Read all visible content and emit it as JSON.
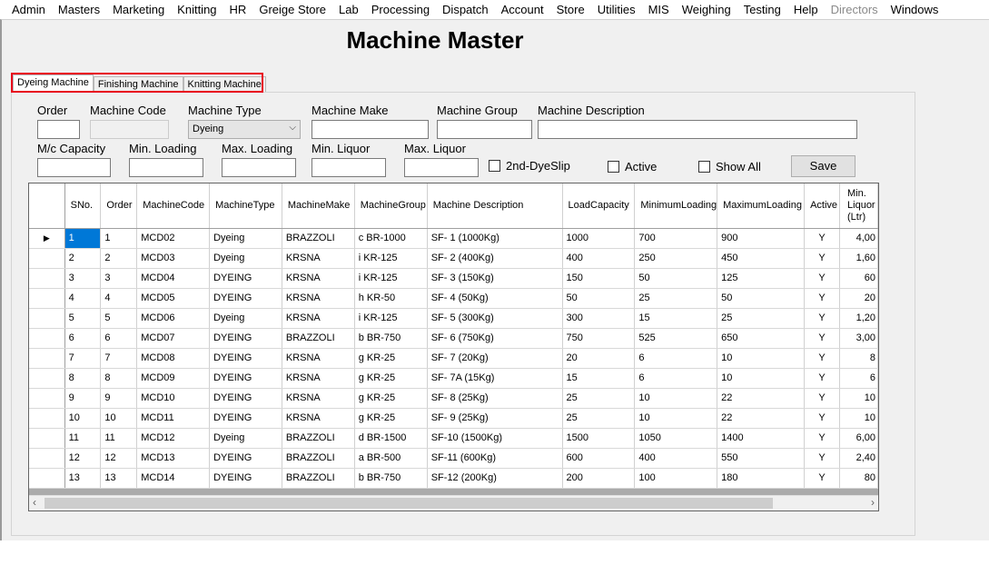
{
  "menu": [
    "Admin",
    "Masters",
    "Marketing",
    "Knitting",
    "HR",
    "Greige Store",
    "Lab",
    "Processing",
    "Dispatch",
    "Account",
    "Store",
    "Utilities",
    "MIS",
    "Weighing",
    "Testing",
    "Help",
    "Directors",
    "Windows"
  ],
  "title": "Machine Master",
  "tabs": [
    "Dyeing Machine",
    "Finishing Machine",
    "Knitting Machine"
  ],
  "form": {
    "order_label": "Order",
    "code_label": "Machine Code",
    "type_label": "Machine Type",
    "type_value": "Dyeing",
    "make_label": "Machine Make",
    "group_label": "Machine Group",
    "desc_label": "Machine Description",
    "capacity_label": "M/c Capacity",
    "min_loading_label": "Min. Loading",
    "max_loading_label": "Max. Loading",
    "min_liquor_label": "Min. Liquor",
    "max_liquor_label": "Max. Liquor",
    "dyeslip_label": "2nd-DyeSlip",
    "active_label": "Active",
    "showall_label": "Show All",
    "save_label": "Save"
  },
  "grid": {
    "columns": [
      "SNo.",
      "Order",
      "MachineCode",
      "MachineType",
      "MachineMake",
      "MachineGroup",
      "Machine Description",
      "LoadCapacity",
      "MinimumLoading",
      "MaximumLoading",
      "Active",
      "Min. Liquor (Ltr)"
    ],
    "rows": [
      [
        "1",
        "1",
        "MCD02",
        "Dyeing",
        "BRAZZOLI",
        "c BR-1000",
        "SF- 1 (1000Kg)",
        "1000",
        "700",
        "900",
        "Y",
        "4,00"
      ],
      [
        "2",
        "2",
        "MCD03",
        "Dyeing",
        "KRSNA",
        "i KR-125",
        "SF- 2 (400Kg)",
        "400",
        "250",
        "450",
        "Y",
        "1,60"
      ],
      [
        "3",
        "3",
        "MCD04",
        "DYEING",
        "KRSNA",
        "i KR-125",
        "SF- 3 (150Kg)",
        "150",
        "50",
        "125",
        "Y",
        "60"
      ],
      [
        "4",
        "4",
        "MCD05",
        "DYEING",
        "KRSNA",
        "h KR-50",
        "SF- 4 (50Kg)",
        "50",
        "25",
        "50",
        "Y",
        "20"
      ],
      [
        "5",
        "5",
        "MCD06",
        "Dyeing",
        "KRSNA",
        "i KR-125",
        "SF- 5 (300Kg)",
        "300",
        "15",
        "25",
        "Y",
        "1,20"
      ],
      [
        "6",
        "6",
        "MCD07",
        "DYEING",
        "BRAZZOLI",
        "b BR-750",
        "SF- 6 (750Kg)",
        "750",
        "525",
        "650",
        "Y",
        "3,00"
      ],
      [
        "7",
        "7",
        "MCD08",
        "DYEING",
        "KRSNA",
        "g KR-25",
        "SF- 7 (20Kg)",
        "20",
        "6",
        "10",
        "Y",
        "8"
      ],
      [
        "8",
        "8",
        "MCD09",
        "DYEING",
        "KRSNA",
        "g KR-25",
        "SF- 7A (15Kg)",
        "15",
        "6",
        "10",
        "Y",
        "6"
      ],
      [
        "9",
        "9",
        "MCD10",
        "DYEING",
        "KRSNA",
        "g KR-25",
        "SF- 8 (25Kg)",
        "25",
        "10",
        "22",
        "Y",
        "10"
      ],
      [
        "10",
        "10",
        "MCD11",
        "DYEING",
        "KRSNA",
        "g KR-25",
        "SF- 9 (25Kg)",
        "25",
        "10",
        "22",
        "Y",
        "10"
      ],
      [
        "11",
        "11",
        "MCD12",
        "Dyeing",
        "BRAZZOLI",
        "d BR-1500",
        "SF-10 (1500Kg)",
        "1500",
        "1050",
        "1400",
        "Y",
        "6,00"
      ],
      [
        "12",
        "12",
        "MCD13",
        "DYEING",
        "BRAZZOLI",
        "a BR-500",
        "SF-11 (600Kg)",
        "600",
        "400",
        "550",
        "Y",
        "2,40"
      ],
      [
        "13",
        "13",
        "MCD14",
        "DYEING",
        "BRAZZOLI",
        "b BR-750",
        "SF-12 (200Kg)",
        "200",
        "100",
        "180",
        "Y",
        "80"
      ]
    ]
  }
}
